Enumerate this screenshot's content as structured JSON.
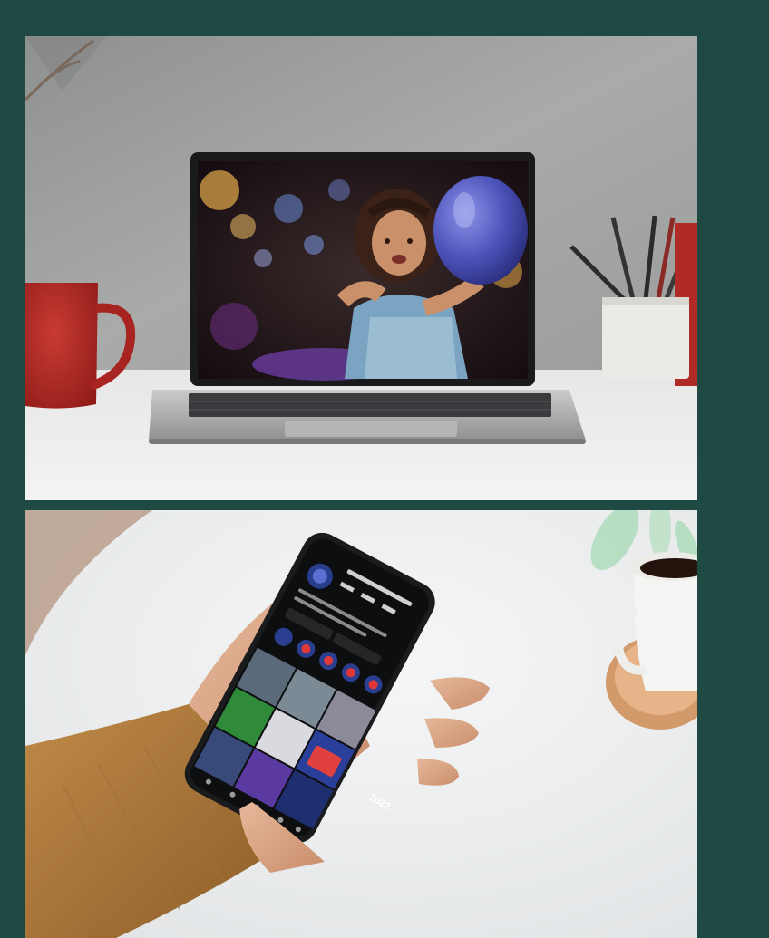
{
  "page": {
    "background_color": "#1e4a43",
    "photos": [
      {
        "name": "laptop-on-desk-photo",
        "objects": [
          "laptop",
          "red-mug",
          "pencil-holder",
          "plant-branch"
        ],
        "screen_content": "child-with-balloon"
      },
      {
        "name": "phone-in-hand-photo",
        "objects": [
          "smartphone",
          "hand",
          "coffee-cup",
          "white-table"
        ],
        "screen_content": "social-profile-app"
      }
    ]
  },
  "phone_screen": {
    "badge_text": "2022"
  }
}
